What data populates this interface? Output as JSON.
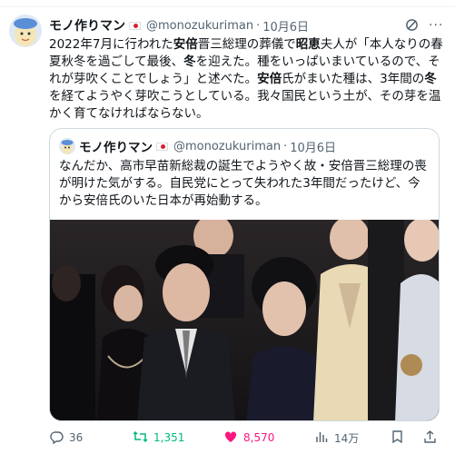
{
  "tweet": {
    "author_name": "モノ作りマン",
    "author_handle": "@monozukuriman",
    "separator": "·",
    "date": "10月6日",
    "body_parts": [
      {
        "text": "2022年7月に行われた",
        "bold": false
      },
      {
        "text": "安倍",
        "bold": true
      },
      {
        "text": "晋三総理の葬儀で",
        "bold": false
      },
      {
        "text": "昭恵",
        "bold": true
      },
      {
        "text": "夫人が「本人なりの春夏秋冬を過ごして最後、",
        "bold": false
      },
      {
        "text": "冬",
        "bold": true
      },
      {
        "text": "を迎えた。種をいっぱいまいているので、それが芽吹くことでしょう」と述べた。",
        "bold": false
      },
      {
        "text": "安倍",
        "bold": true
      },
      {
        "text": "氏がまいた種は、3年間の",
        "bold": false
      },
      {
        "text": "冬",
        "bold": true
      },
      {
        "text": "を経てようやく芽吹こうとしている。我々国民という土が、その芽を温かく育てなければならない。",
        "bold": false
      }
    ]
  },
  "quote": {
    "author_name": "モノ作りマン",
    "author_handle": "@monozukuriman",
    "separator": "·",
    "date": "10月6日",
    "body": "なんだか、高市早苗新総裁の誕生でようやく故・安倍晋三総理の喪が明けた気がする。自民党にとって失われた3年間だったけど、今から安倍氏のいた日本が再始動する。"
  },
  "actions": {
    "replies": "36",
    "retweets": "1,351",
    "likes": "8,570",
    "views": "14万"
  },
  "colors": {
    "retweet": "#00ba7c",
    "like": "#f91880",
    "muted": "#536471",
    "flag_red": "#d62130"
  },
  "icons": [
    "grok-icon",
    "more-icon",
    "reply-icon",
    "retweet-icon",
    "heart-icon",
    "views-icon",
    "bookmark-icon",
    "share-icon"
  ]
}
